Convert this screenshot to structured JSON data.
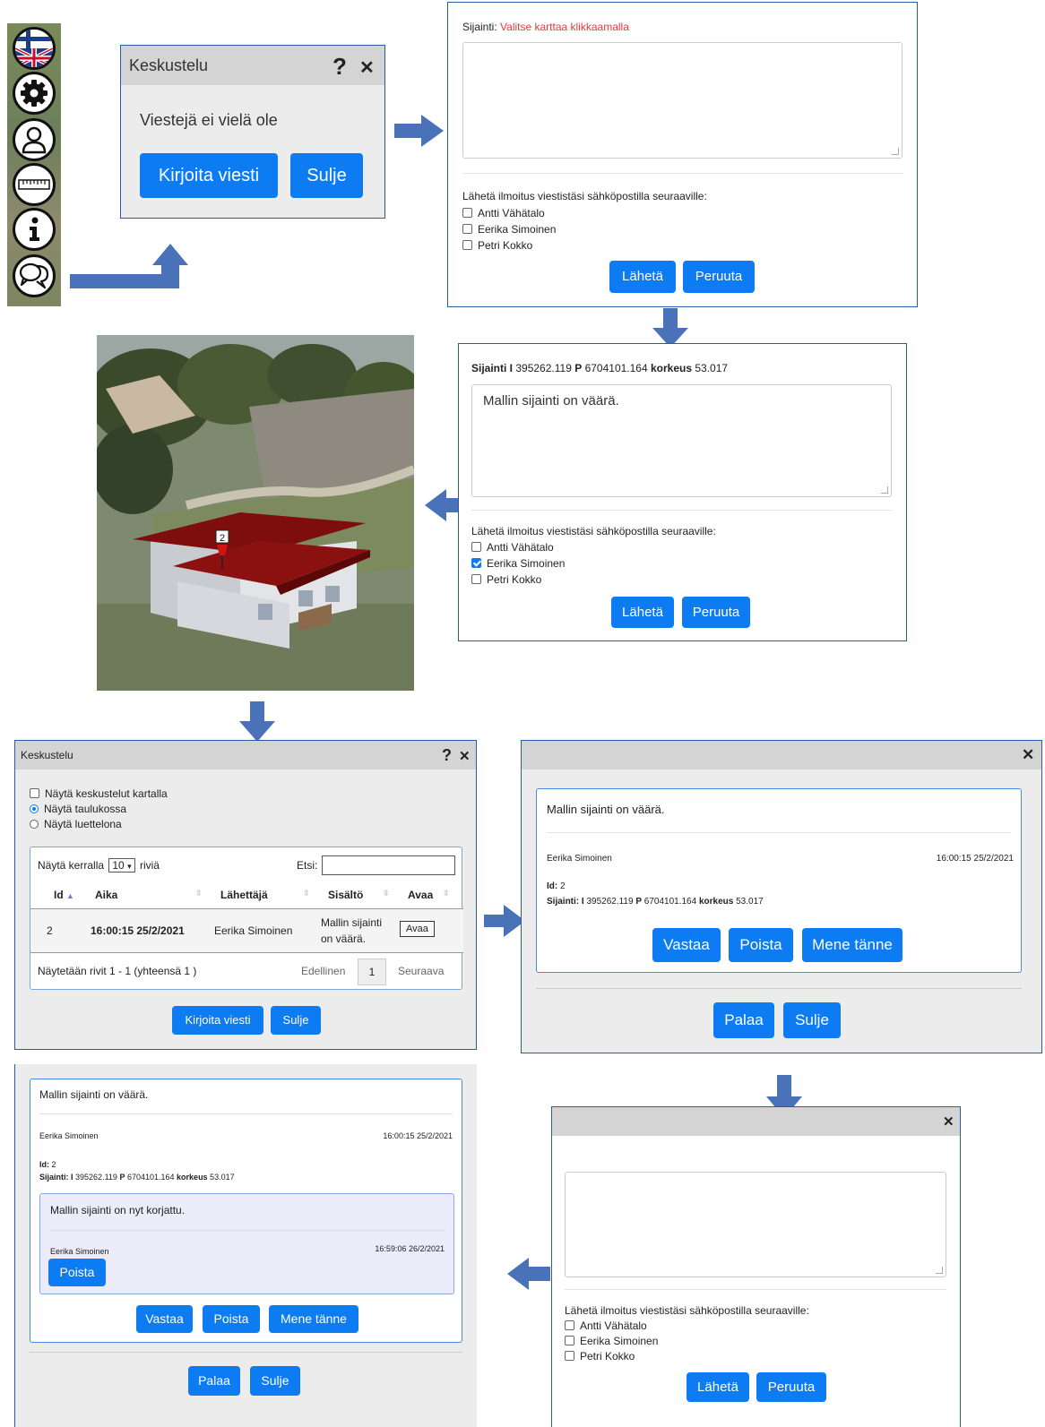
{
  "colors": {
    "accent": "#0d7cf2",
    "arrow": "#4a72b8",
    "error": "#e03c3c",
    "roof": "#8b1010"
  },
  "toolbar": {
    "icons": [
      "flag-fi-gb-icon",
      "gear-icon",
      "user-icon",
      "ruler-icon",
      "info-icon",
      "chat-icon"
    ]
  },
  "chat_empty": {
    "title": "Keskustelu",
    "help": "?",
    "close": "✕",
    "message": "Viestejä ei vielä ole",
    "write_button": "Kirjoita viesti",
    "close_button": "Sulje"
  },
  "form1": {
    "location_label": "Sijainti:",
    "location_hint": "Valitse karttaa klikkaamalla",
    "notify_label": "Lähetä ilmoitus viestistäsi sähköpostilla seuraaville:",
    "recipients": [
      "Antti Vähätalo",
      "Eerika Simoinen",
      "Petri Kokko"
    ],
    "send_button": "Lähetä",
    "cancel_button": "Peruuta"
  },
  "form2": {
    "loc_i_label": "Sijainti I",
    "loc_i_value": "395262.119",
    "loc_p_label": "P",
    "loc_p_value": "6704101.164",
    "loc_h_label": "korkeus",
    "loc_h_value": "53.017",
    "message_text": "Mallin sijainti on väärä.",
    "notify_label": "Lähetä ilmoitus viestistäsi sähköpostilla seuraaville:",
    "recipients": [
      "Antti Vähätalo",
      "Eerika Simoinen",
      "Petri Kokko"
    ],
    "checked": [
      false,
      true,
      false
    ],
    "send_button": "Lähetä",
    "cancel_button": "Peruuta"
  },
  "scene": {
    "marker_label": "2"
  },
  "list_dialog": {
    "title": "Keskustelu",
    "help": "?",
    "close": "✕",
    "options": [
      "Näytä keskustelut kartalla",
      "Näytä taulukossa",
      "Näytä luettelona"
    ],
    "show_label": "Näytä kerralla",
    "page_size": "10",
    "rows_label": "riviä",
    "search_label": "Etsi:",
    "columns": [
      "Id",
      "Aika",
      "Lähettäjä",
      "Sisältö",
      "Avaa"
    ],
    "row": {
      "id": "2",
      "time": "16:00:15 25/2/2021",
      "sender": "Eerika Simoinen",
      "content_line1": "Mallin sijainti",
      "content_line2": "on väärä.",
      "open": "Avaa"
    },
    "info": "Näytetään rivit 1 - 1 (yhteensä 1 )",
    "prev": "Edellinen",
    "page": "1",
    "next": "Seuraava",
    "write_button": "Kirjoita viesti",
    "close_button": "Sulje"
  },
  "detail": {
    "close": "✕",
    "message": "Mallin sijainti on väärä.",
    "sender": "Eerika Simoinen",
    "time": "16:00:15 25/2/2021",
    "id_label": "Id:",
    "id_value": "2",
    "loc_label": "Sijainti: I",
    "loc_i_value": "395262.119",
    "loc_p_label": "P",
    "loc_p_value": "6704101.164",
    "loc_h_label": "korkeus",
    "loc_h_value": "53.017",
    "reply_button": "Vastaa",
    "delete_button": "Poista",
    "goto_button": "Mene tänne",
    "back_button": "Palaa",
    "close_button": "Sulje"
  },
  "thread": {
    "message": "Mallin sijainti on väärä.",
    "sender": "Eerika Simoinen",
    "time": "16:00:15 25/2/2021",
    "id_label": "Id:",
    "id_value": "2",
    "loc_label": "Sijainti: I",
    "loc_i_value": "395262.119",
    "loc_p_label": "P",
    "loc_p_value": "6704101.164",
    "loc_h_label": "korkeus",
    "loc_h_value": "53.017",
    "reply_message": "Mallin sijainti on nyt korjattu.",
    "reply_sender": "Eerika Simoinen",
    "reply_time": "16:59:06 26/2/2021",
    "reply_delete": "Poista",
    "reply_button": "Vastaa",
    "delete_button": "Poista",
    "goto_button": "Mene tänne",
    "back_button": "Palaa",
    "close_button": "Sulje"
  },
  "reply_form": {
    "close": "✕",
    "notify_label": "Lähetä ilmoitus viestistäsi sähköpostilla seuraaville:",
    "recipients": [
      "Antti Vähätalo",
      "Eerika Simoinen",
      "Petri Kokko"
    ],
    "send_button": "Lähetä",
    "cancel_button": "Peruuta"
  }
}
